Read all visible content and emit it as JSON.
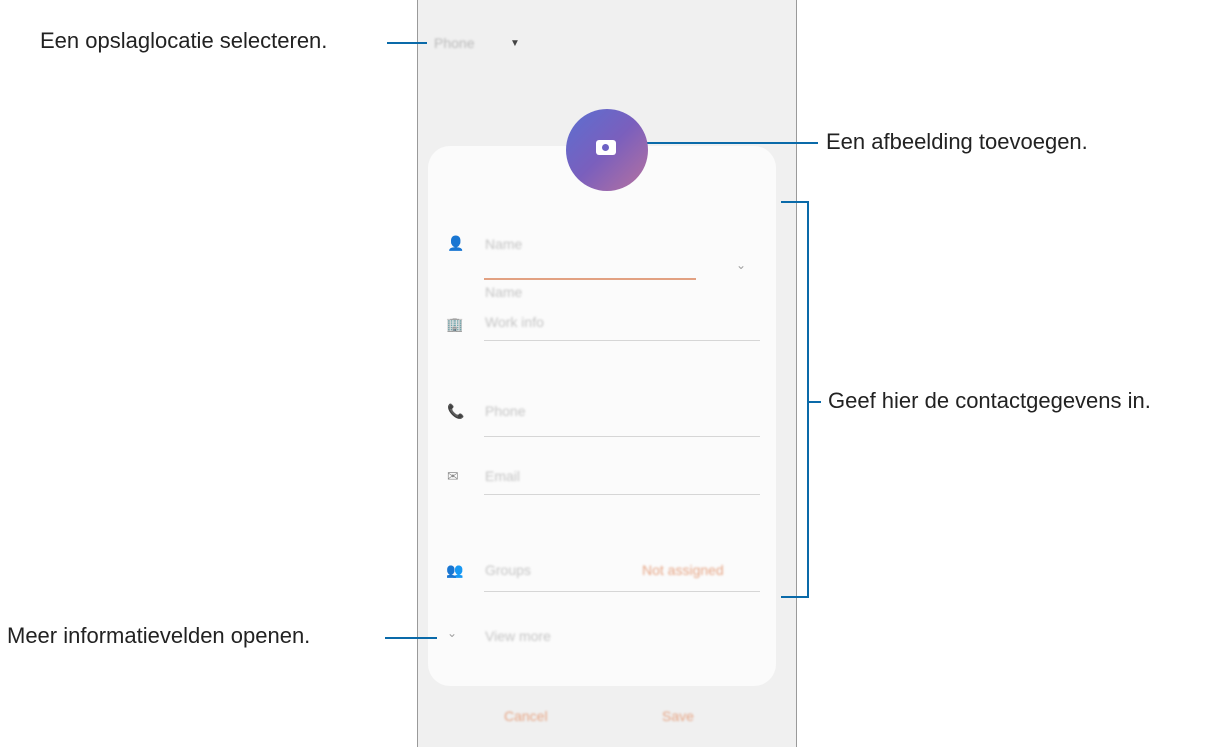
{
  "annotations": {
    "storage": "Een opslaglocatie selecteren.",
    "image": "Een afbeelding toevoegen.",
    "contact": "Geef hier de contactgegevens in.",
    "more": "Meer informatievelden openen."
  },
  "phone": {
    "storage_label": "Phone",
    "fields": {
      "name_label": "Name",
      "name_field": "Name",
      "work_info": "Work info",
      "phone": "Phone",
      "email": "Email",
      "groups": "Groups",
      "groups_value": "Not assigned",
      "view_more": "View more"
    },
    "footer": {
      "cancel": "Cancel",
      "save": "Save"
    }
  },
  "colors": {
    "accent": "#e6a585",
    "callout": "#0a6aa9",
    "photo_gradient_start": "#5b6fd1",
    "photo_gradient_end": "#b7729f"
  }
}
